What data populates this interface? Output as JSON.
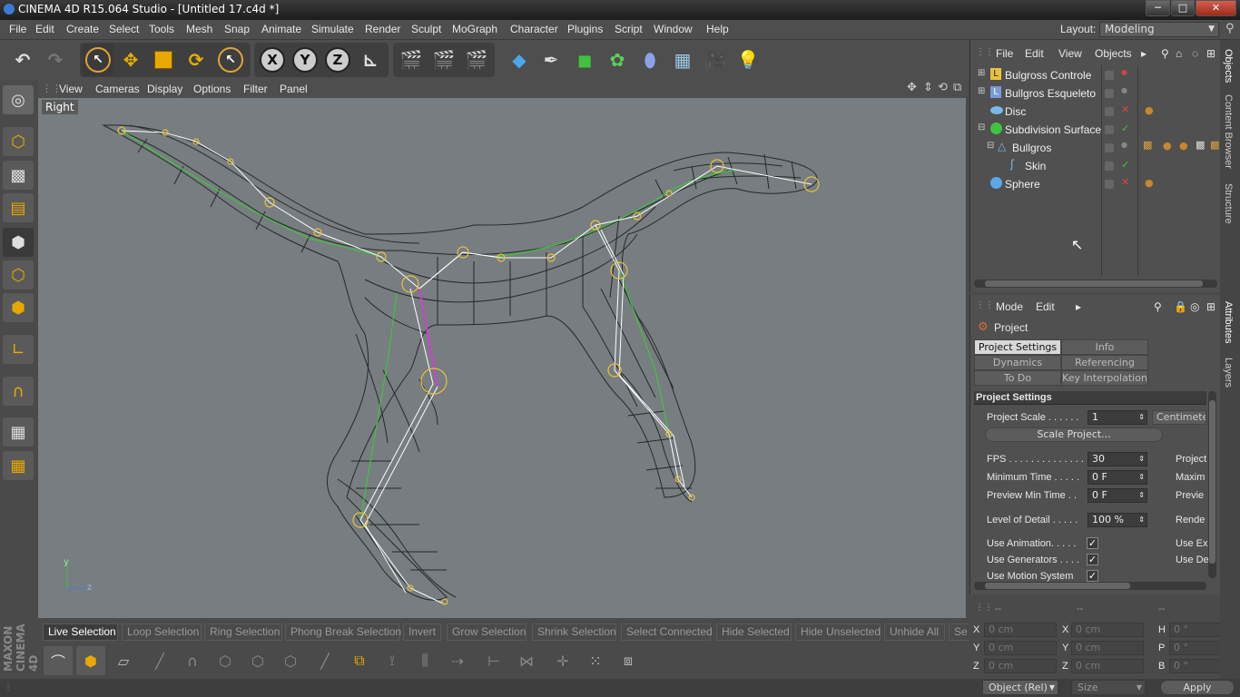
{
  "titlebar": {
    "title": "CINEMA 4D R15.064 Studio - [Untitled 17.c4d *]",
    "minimize": "─",
    "maximize": "□",
    "close": "✕"
  },
  "menubar": {
    "items": [
      "File",
      "Edit",
      "Create",
      "Select",
      "Tools",
      "Mesh",
      "Snap",
      "Animate",
      "Simulate",
      "Render",
      "Sculpt",
      "MoGraph",
      "Character",
      "Plugins",
      "Script",
      "Window",
      "Help"
    ],
    "layout_label": "Layout:",
    "layout_value": "Modeling"
  },
  "toolbar": {
    "axis_x": "X",
    "axis_y": "Y",
    "axis_z": "Z"
  },
  "viewport": {
    "menu": [
      "View",
      "Cameras",
      "Display",
      "Options",
      "Filter",
      "Panel"
    ],
    "label": "Right",
    "axis_y": "y",
    "axis_z": "z"
  },
  "side_brand": "MAXON CINEMA 4D",
  "bottom_bar": [
    "Live Selection",
    "Loop Selection",
    "Ring Selection",
    "Phong Break Selection",
    "Invert",
    "Grow Selection",
    "Shrink Selection",
    "Select Connected",
    "Hide Selected",
    "Hide Unselected",
    "Unhide All",
    "Se"
  ],
  "objects_panel": {
    "menu": [
      "File",
      "Edit",
      "View",
      "Objects"
    ],
    "items": [
      {
        "name": "Bulgross Controle"
      },
      {
        "name": "Bullgros Esqueleto"
      },
      {
        "name": "Disc"
      },
      {
        "name": "Subdivision Surface"
      },
      {
        "name": "Bullgros"
      },
      {
        "name": "Skin"
      },
      {
        "name": "Sphere"
      }
    ]
  },
  "attributes_panel": {
    "menu": [
      "Mode",
      "Edit"
    ],
    "title": "Project",
    "tabs": [
      "Project Settings",
      "Info",
      "Dynamics",
      "Referencing",
      "To Do",
      "Key Interpolation"
    ],
    "section": "Project Settings",
    "project_scale_label": "Project Scale . . . . . .",
    "project_scale_value": "1",
    "project_scale_unit": "Centimete",
    "scale_project_button": "Scale Project...",
    "fps_label": "FPS . . . . . . . . . . . . . .",
    "fps_value": "30",
    "min_time_label": "Minimum Time . . . . .",
    "min_time_value": "0 F",
    "preview_min_label": "Preview Min Time . .",
    "preview_min_value": "0 F",
    "lod_label": "Level of Detail . . . . .",
    "lod_value": "100 %",
    "use_animation": "Use Animation. . . . .",
    "use_generators": "Use Generators . . . .",
    "use_motion": "Use Motion System",
    "right_col": [
      "Project",
      "Maxim",
      "Previe",
      "Rende",
      "Use Ex",
      "Use De"
    ]
  },
  "side_tabs": [
    "Objects",
    "Content Browser",
    "Structure",
    "Attributes",
    "Layers"
  ],
  "coords": {
    "labels": [
      "X",
      "Y",
      "Z",
      "X",
      "Y",
      "Z",
      "H",
      "P",
      "B"
    ],
    "pos": [
      "0 cm",
      "0 cm",
      "0 cm"
    ],
    "size": [
      "0 cm",
      "0 cm",
      "0 cm"
    ],
    "rot": [
      "0 °",
      "0 °",
      "0 °"
    ],
    "header": [
      "--",
      "--",
      "--"
    ],
    "mode": "Object (Rel)",
    "size_mode": "Size",
    "apply": "Apply"
  }
}
